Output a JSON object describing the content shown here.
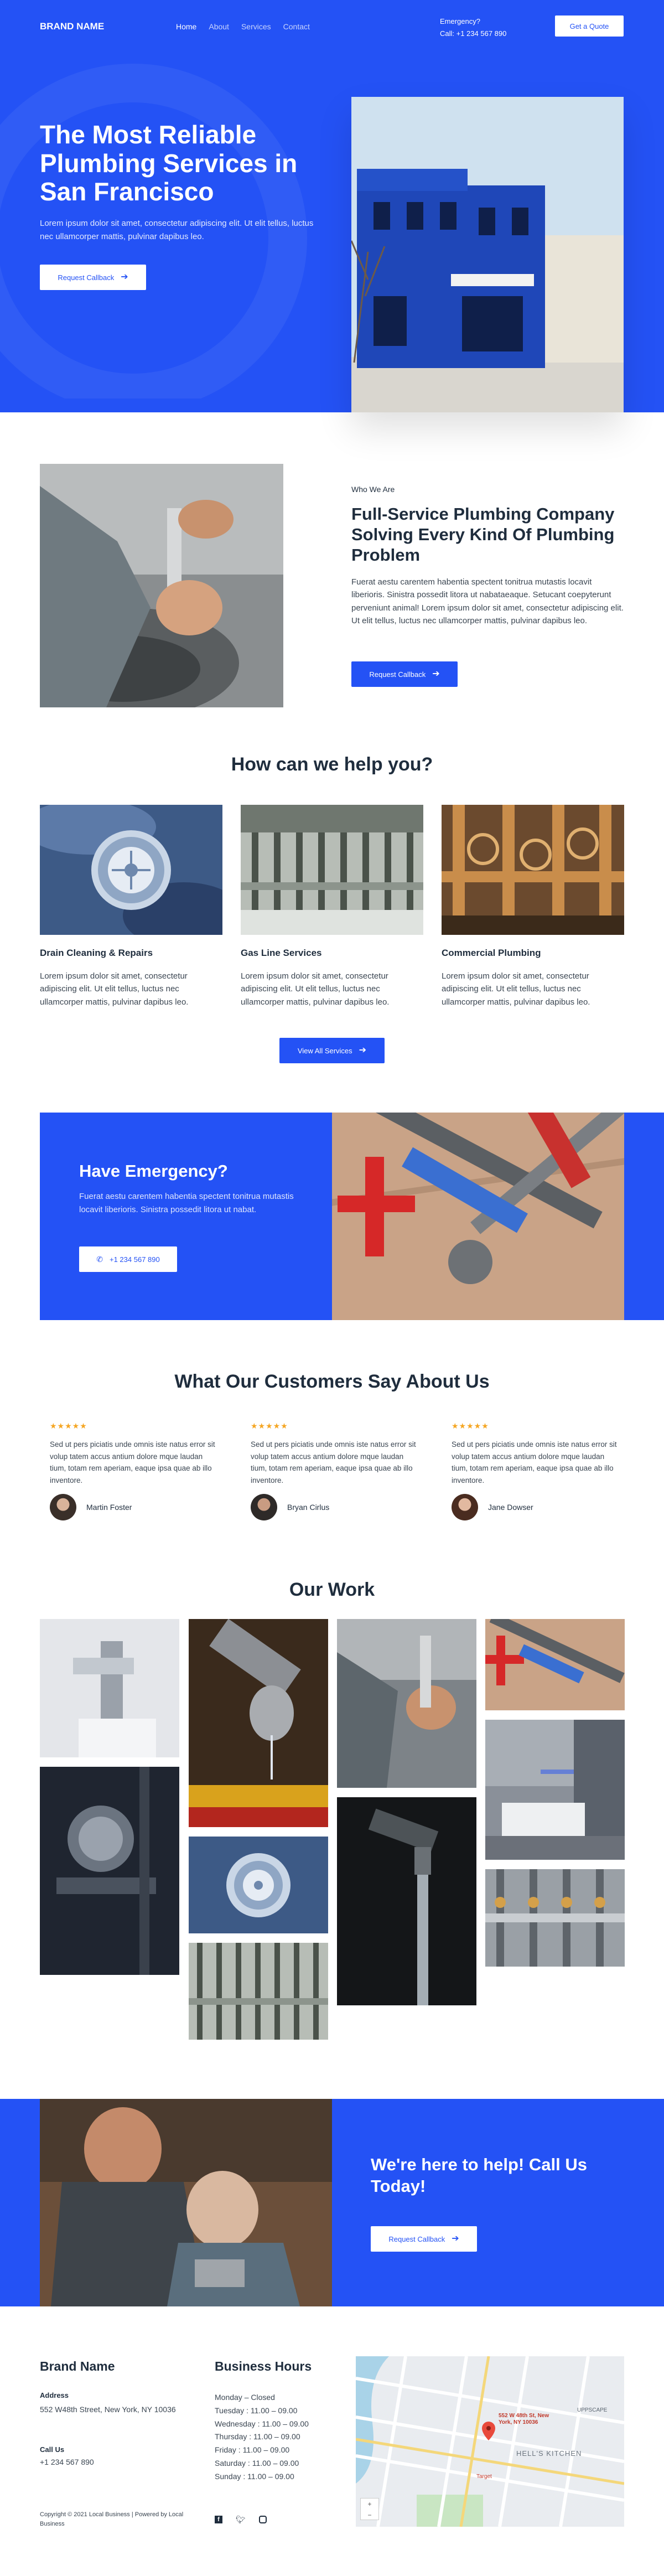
{
  "header": {
    "brand": "BRAND NAME",
    "nav": [
      "Home",
      "About",
      "Services",
      "Contact"
    ],
    "emergency_label": "Emergency?",
    "emergency_call": "Call: +1 234 567 890",
    "quote_button": "Get a Quote"
  },
  "hero": {
    "title": "The Most Reliable Plumbing Services in San Francisco",
    "text": "Lorem ipsum dolor sit amet, consectetur adipiscing elit. Ut elit tellus, luctus nec ullamcorper mattis, pulvinar dapibus leo.",
    "button": "Request Callback"
  },
  "about": {
    "eyebrow": "Who We Are",
    "title": "Full-Service Plumbing Company Solving Every Kind Of Plumbing Problem",
    "text": "Fuerat aestu carentem habentia spectent tonitrua mutastis locavit liberioris. Sinistra possedit litora ut nabataeaque. Setucant coepyterunt perveniunt animal! Lorem ipsum dolor sit amet, consectetur adipiscing elit. Ut elit tellus, luctus nec ullamcorper mattis, pulvinar dapibus leo.",
    "button": "Request Callback"
  },
  "services": {
    "title": "How can we help you?",
    "items": [
      {
        "title": "Drain Cleaning & Repairs",
        "text": "Lorem ipsum dolor sit amet, consectetur adipiscing elit. Ut elit tellus, luctus nec ullamcorper mattis, pulvinar dapibus leo."
      },
      {
        "title": "Gas Line Services",
        "text": "Lorem ipsum dolor sit amet, consectetur adipiscing elit. Ut elit tellus, luctus nec ullamcorper mattis, pulvinar dapibus leo."
      },
      {
        "title": "Commercial Plumbing",
        "text": "Lorem ipsum dolor sit amet, consectetur adipiscing elit. Ut elit tellus, luctus nec ullamcorper mattis, pulvinar dapibus leo."
      }
    ],
    "button": "View All Services"
  },
  "emergency": {
    "title": "Have Emergency?",
    "text": "Fuerat aestu carentem habentia spectent tonitrua mutastis locavit liberioris. Sinistra possedit litora ut nabat.",
    "phone": "+1 234 567 890"
  },
  "testimonials": {
    "title": "What Our Customers Say About Us",
    "stars": "★★★★★",
    "items": [
      {
        "text": "Sed ut pers piciatis unde omnis iste natus error sit volup tatem accus antium dolore mque laudan tium, totam rem aperiam, eaque ipsa quae ab illo inventore.",
        "name": "Martin Foster"
      },
      {
        "text": "Sed ut pers piciatis unde omnis iste natus error sit volup tatem accus antium dolore mque laudan tium, totam rem aperiam, eaque ipsa quae ab illo inventore.",
        "name": "Bryan Cirlus"
      },
      {
        "text": "Sed ut pers piciatis unde omnis iste natus error sit volup tatem accus antium dolore mque laudan tium, totam rem aperiam, eaque ipsa quae ab illo inventore.",
        "name": "Jane Dowser"
      }
    ]
  },
  "work": {
    "title": "Our Work"
  },
  "cta": {
    "title": "We're here to help! Call Us Today!",
    "button": "Request Callback"
  },
  "footer": {
    "brand": "Brand Name",
    "address_label": "Address",
    "address": "552 W48th Street, New York, NY 10036",
    "call_label": "Call Us",
    "phone": "+1 234 567 890",
    "hours_title": "Business Hours",
    "hours": [
      "Monday – Closed",
      "Tuesday : 11.00 – 09.00",
      "Wednesday : 11.00 – 09.00",
      "Thursday : 11.00 – 09.00",
      "Friday : 11.00 – 09.00",
      "Saturday : 11.00 – 09.00",
      "Sunday : 11.00 – 09.00"
    ],
    "map_address": "552 W 48th St, New York, NY 10036",
    "map_labels": [
      "HELL'S KITCHEN",
      "UPPSCAPE",
      "Target"
    ],
    "copyright": "Copyright © 2021 Local Business | Powered by Local Business"
  },
  "colors": {
    "accent": "#2452f5",
    "star": "#f5a623",
    "text": "#1f2d3d"
  }
}
